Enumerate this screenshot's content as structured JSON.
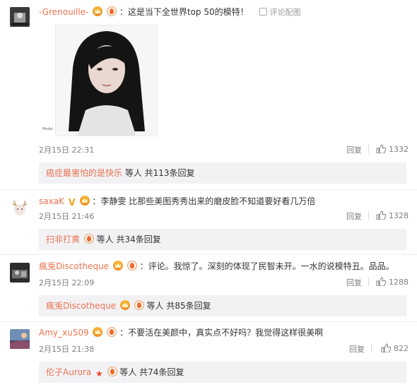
{
  "comments": [
    {
      "username": "-Grenouille-",
      "text": "：这是当下全世界top 50的模特！",
      "report_label": "评论配图",
      "image_caption": "Model",
      "date": "2月15日 22:31",
      "reply_label": "回复",
      "likes": "1332",
      "replies_prefix": "癌症最害怕的是快乐",
      "replies_suffix": " 等人 共113条回复"
    },
    {
      "username": "saxaK",
      "text": "：李静雯 比那些美图秀秀出来的磨皮脸不知道要好看几万倍",
      "date": "2月15日 21:46",
      "reply_label": "回复",
      "likes": "1328",
      "replies_prefix": "扫非打黄",
      "replies_suffix": " 等人 共34条回复"
    },
    {
      "username": "瘋兎Discotheque",
      "text": "：评论。我惊了。深刻的体现了民智未开。一水的说模特丑。品品。",
      "date": "2月15日 22:09",
      "reply_label": "回复",
      "likes": "1288",
      "replies_prefix": "瘋兎Discotheque",
      "replies_suffix": " 等人 共85条回复"
    },
    {
      "username": "Amy_xu509",
      "text": "：不要活在美颜中，真实点不好吗？我觉得这样很美啊",
      "date": "2月15日 21:38",
      "reply_label": "回复",
      "likes": "822",
      "replies_prefix": "伦子Aurora",
      "replies_suffix": " 等人 共74条回复"
    }
  ],
  "colors": {
    "username": "#eb7350",
    "meta": "#808080",
    "reply_box": "#f2f2f5"
  }
}
